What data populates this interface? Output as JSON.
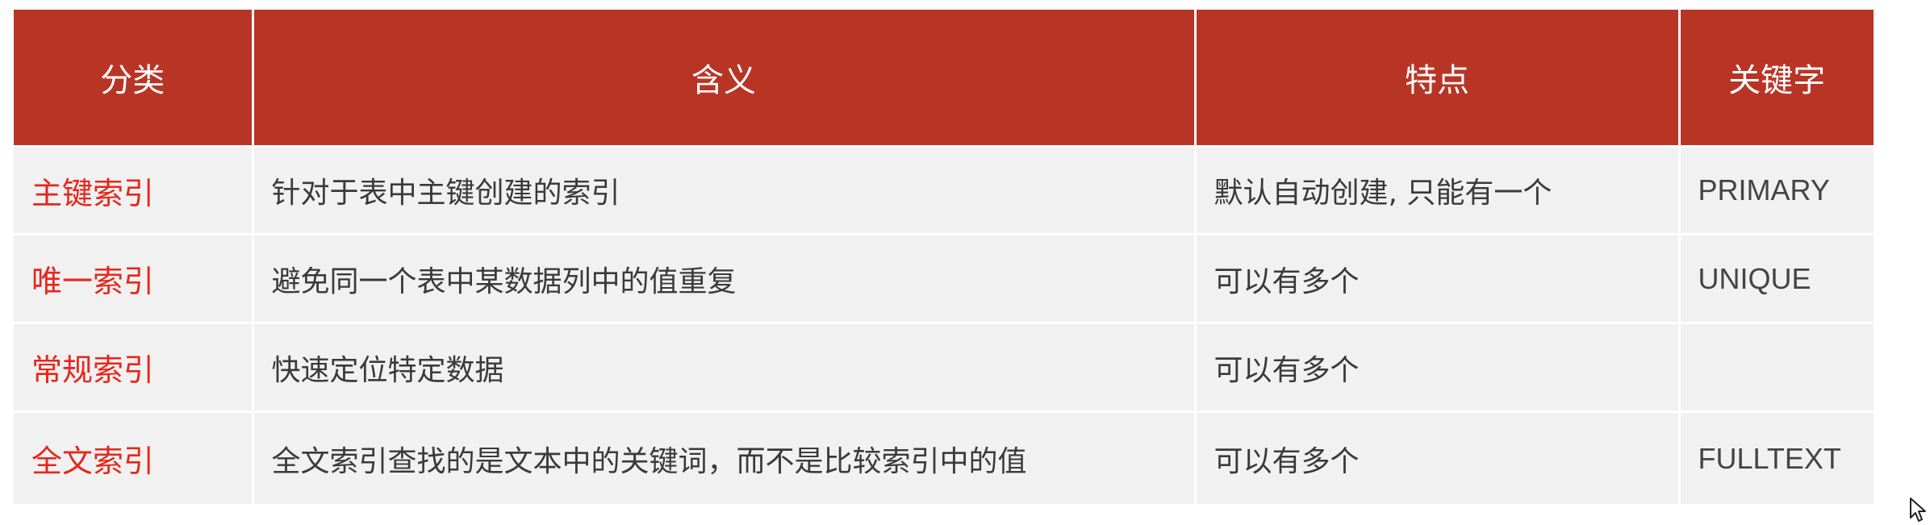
{
  "table": {
    "headers": [
      "分类",
      "含义",
      "特点",
      "关键字"
    ],
    "rows": [
      {
        "category": "主键索引",
        "meaning": "针对于表中主键创建的索引",
        "feature": "默认自动创建, 只能有一个",
        "keyword": "PRIMARY"
      },
      {
        "category": "唯一索引",
        "meaning": "避免同一个表中某数据列中的值重复",
        "feature": "可以有多个",
        "keyword": "UNIQUE"
      },
      {
        "category": "常规索引",
        "meaning": "快速定位特定数据",
        "feature": "可以有多个",
        "keyword": ""
      },
      {
        "category": "全文索引",
        "meaning": "全文索引查找的是文本中的关键词，而不是比较索引中的值",
        "feature": "可以有多个",
        "keyword": "FULLTEXT"
      }
    ]
  },
  "colors": {
    "header_bg": "#b83526",
    "header_text": "#ffffff",
    "category_text": "#e6271c",
    "cell_bg": "#f1f1f1",
    "cell_text": "#3a3a3a"
  },
  "cursor": {
    "icon": "mouse-pointer-icon"
  }
}
